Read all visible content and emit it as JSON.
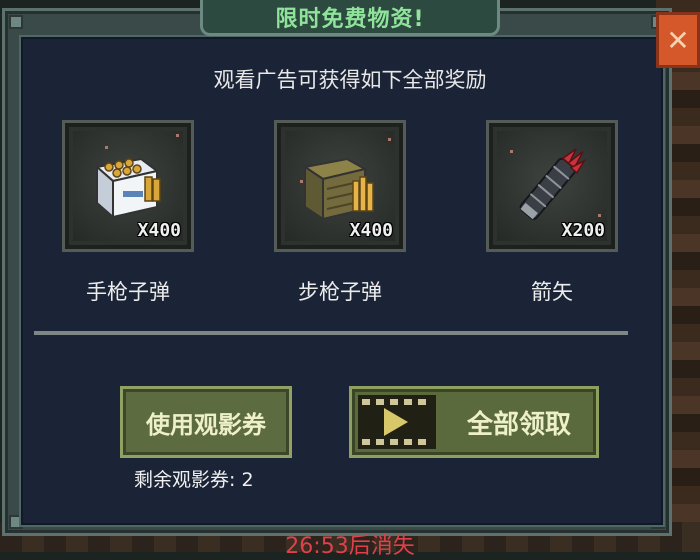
{
  "dialog": {
    "title": "限时免费物资!",
    "subtitle": "观看广告可获得如下全部奖励",
    "close_icon": "close-icon"
  },
  "rewards": [
    {
      "label": "手枪子弹",
      "count": "X400",
      "icon": "pistol-ammo-box-icon"
    },
    {
      "label": "步枪子弹",
      "count": "X400",
      "icon": "rifle-ammo-crate-icon"
    },
    {
      "label": "箭矢",
      "count": "X200",
      "icon": "arrow-quiver-icon"
    }
  ],
  "buttons": {
    "use_coupon": "使用观影券",
    "claim_all": "全部领取",
    "claim_icon": "film-play-icon"
  },
  "coupon_remaining": "剩余观影券: 2",
  "timer_text": "26:53后消失",
  "colors": {
    "title": "#8fe39a",
    "timer": "#e0404a",
    "close_button": "#d4582a",
    "button_bg": "#5d6b40"
  }
}
